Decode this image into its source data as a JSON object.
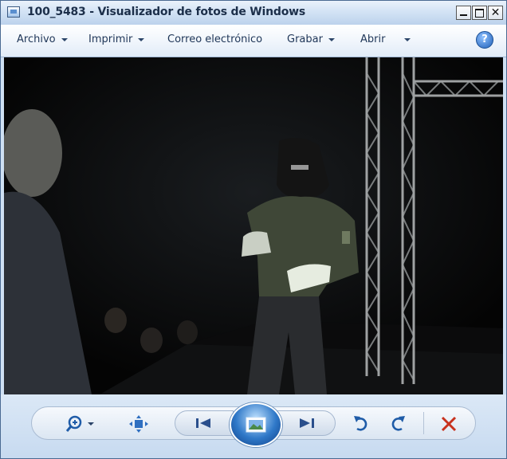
{
  "window": {
    "title": "100_5483 - Visualizador de fotos de Windows"
  },
  "menu": {
    "items": [
      {
        "id": "archivo",
        "label": "Archivo",
        "has_dropdown": true
      },
      {
        "id": "imprimir",
        "label": "Imprimir",
        "has_dropdown": true
      },
      {
        "id": "correo",
        "label": "Correo electrónico",
        "has_dropdown": false
      },
      {
        "id": "grabar",
        "label": "Grabar",
        "has_dropdown": true
      },
      {
        "id": "abrir",
        "label": "Abrir",
        "has_dropdown": true
      }
    ],
    "help_label": "?"
  },
  "controls": {
    "zoom_icon": "zoom-magnifier-icon",
    "fit_icon": "actual-size-icon",
    "prev_icon": "previous-icon",
    "slideshow_icon": "slideshow-icon",
    "next_icon": "next-icon",
    "rotate_left_icon": "rotate-counterclockwise-icon",
    "rotate_right_icon": "rotate-clockwise-icon",
    "delete_icon": "delete-icon",
    "delete_color": "#c8321e",
    "accent_color": "#2f78c8"
  },
  "window_buttons": {
    "close_glyph": "✕"
  }
}
